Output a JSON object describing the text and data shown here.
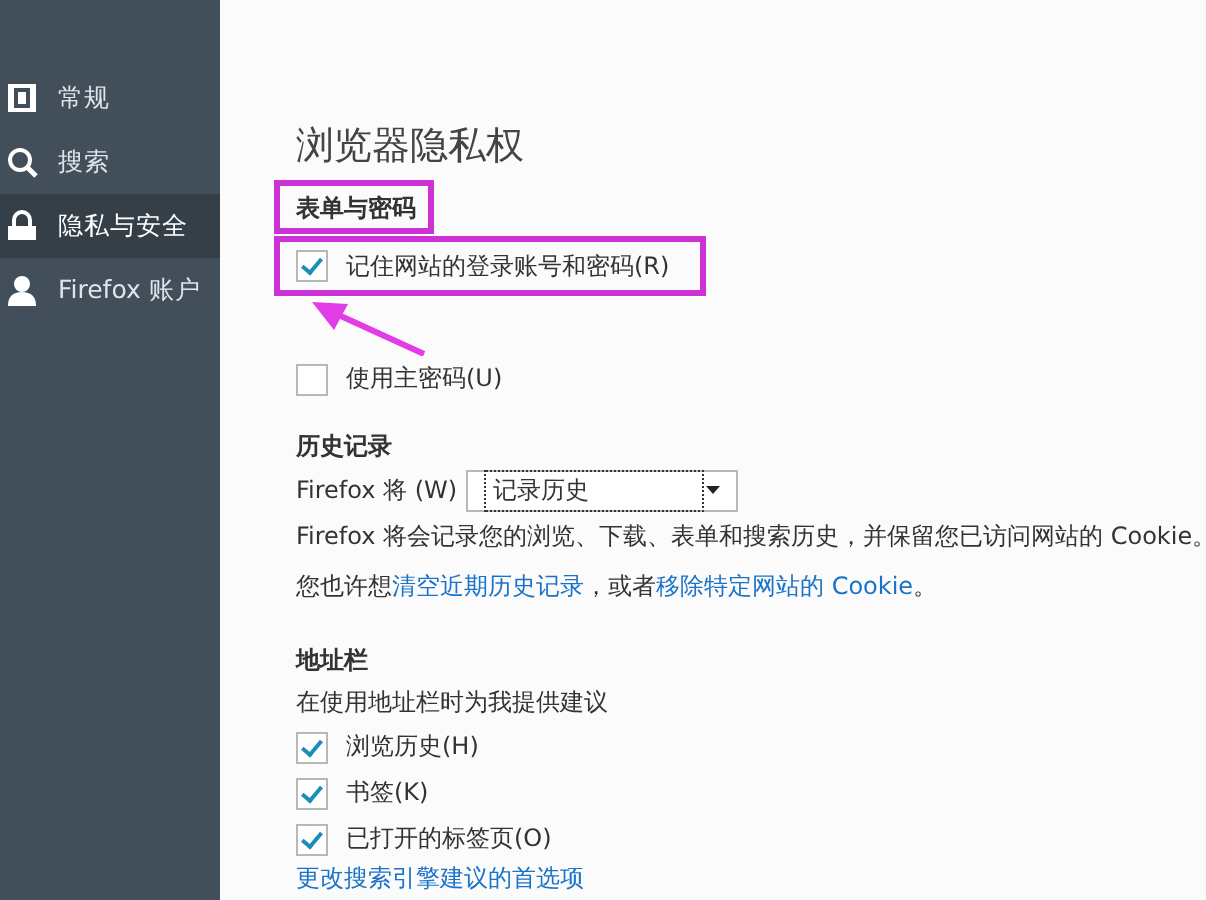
{
  "sidebar": {
    "items": [
      {
        "kind": "general",
        "label": "常规",
        "selected": false
      },
      {
        "kind": "search",
        "label": "搜索",
        "selected": false
      },
      {
        "kind": "privacy",
        "label": "隐私与安全",
        "selected": true
      },
      {
        "kind": "account",
        "label": "Firefox 账户",
        "selected": false
      }
    ]
  },
  "title": "浏览器隐私权",
  "forms": {
    "heading": "表单与密码",
    "options": [
      {
        "label": "记住网站的登录账号和密码(R)",
        "checked": true
      },
      {
        "label": "使用主密码(U)",
        "checked": false
      }
    ]
  },
  "history": {
    "heading": "历史记录",
    "select_label": "Firefox 将 (W)",
    "select_value": "记录历史",
    "description": "Firefox 将会记录您的浏览、下载、表单和搜索历史，并保留您已访问网站的 Cookie。",
    "hint_before": "您也许想",
    "link_clear": "清空近期历史记录",
    "hint_middle": "，或者",
    "link_remove": "移除特定网站的 Cookie",
    "hint_after": "。"
  },
  "address_bar": {
    "heading": "地址栏",
    "description": "在使用地址栏时为我提供建议",
    "options": [
      {
        "label": "浏览历史(H)",
        "checked": true
      },
      {
        "label": "书签(K)",
        "checked": true
      },
      {
        "label": "已打开的标签页(O)",
        "checked": true
      }
    ],
    "link": "更改搜索引擎建议的首选项"
  }
}
